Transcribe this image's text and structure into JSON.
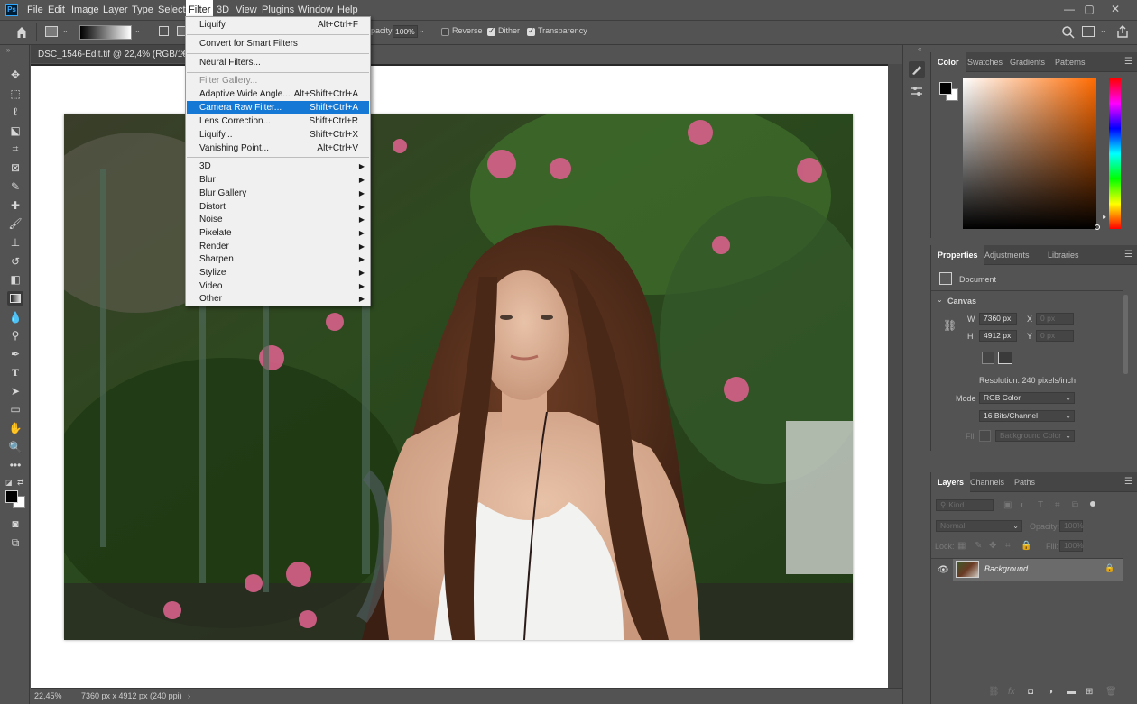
{
  "app": {
    "logo": "Ps"
  },
  "menubar": {
    "items": [
      "File",
      "Edit",
      "Image",
      "Layer",
      "Type",
      "Select",
      "Filter",
      "3D",
      "View",
      "Plugins",
      "Window",
      "Help"
    ],
    "active": "Filter"
  },
  "window_controls": {
    "minimize": "—",
    "maximize": "▢",
    "close": "✕"
  },
  "options_bar": {
    "opacity_label": "Opacity:",
    "opacity_value": "100%",
    "reverse_label": "Reverse",
    "reverse_checked": false,
    "dither_label": "Dither",
    "dither_checked": true,
    "transparency_label": "Transparency",
    "transparency_checked": true
  },
  "document": {
    "tab_title": "DSC_1546-Edit.tif @ 22,4% (RGB/16*)",
    "close_glyph": "×"
  },
  "filter_menu": {
    "items": [
      {
        "label": "Liquify",
        "shortcut": "Alt+Ctrl+F"
      },
      {
        "sep": true
      },
      {
        "label": "Convert for Smart Filters"
      },
      {
        "sep": true
      },
      {
        "label": "Neural Filters..."
      },
      {
        "sep": true
      },
      {
        "label": "Filter Gallery...",
        "disabled": true
      },
      {
        "label": "Adaptive Wide Angle...",
        "shortcut": "Alt+Shift+Ctrl+A"
      },
      {
        "label": "Camera Raw Filter...",
        "shortcut": "Shift+Ctrl+A",
        "highlighted": true
      },
      {
        "label": "Lens Correction...",
        "shortcut": "Shift+Ctrl+R"
      },
      {
        "label": "Liquify...",
        "shortcut": "Shift+Ctrl+X"
      },
      {
        "label": "Vanishing Point...",
        "shortcut": "Alt+Ctrl+V"
      },
      {
        "sep": true
      },
      {
        "label": "3D",
        "submenu": true
      },
      {
        "label": "Blur",
        "submenu": true
      },
      {
        "label": "Blur Gallery",
        "submenu": true
      },
      {
        "label": "Distort",
        "submenu": true
      },
      {
        "label": "Noise",
        "submenu": true
      },
      {
        "label": "Pixelate",
        "submenu": true
      },
      {
        "label": "Render",
        "submenu": true
      },
      {
        "label": "Sharpen",
        "submenu": true
      },
      {
        "label": "Stylize",
        "submenu": true
      },
      {
        "label": "Video",
        "submenu": true
      },
      {
        "label": "Other",
        "submenu": true
      }
    ]
  },
  "status_bar": {
    "zoom": "22,45%",
    "doc_info": "7360 px x 4912 px (240 ppi)",
    "arrow": "›"
  },
  "color_panel": {
    "tabs": [
      "Color",
      "Swatches",
      "Gradients",
      "Patterns"
    ],
    "active_tab": "Color",
    "foreground": "#000000",
    "background": "#ffffff",
    "hue_color": "#ff6a00"
  },
  "properties_panel": {
    "tabs": [
      "Properties",
      "Adjustments",
      "Libraries"
    ],
    "active_tab": "Properties",
    "doc_label": "Document",
    "section": "Canvas",
    "w_label": "W",
    "w_value": "7360 px",
    "h_label": "H",
    "h_value": "4912 px",
    "x_label": "X",
    "x_value": "0 px",
    "y_label": "Y",
    "y_value": "0 px",
    "resolution": "Resolution: 240 pixels/inch",
    "mode_label": "Mode",
    "mode_value": "RGB Color",
    "bits_value": "16 Bits/Channel",
    "fill_label": "Fill",
    "fill_value": "Background Color"
  },
  "layers_panel": {
    "tabs": [
      "Layers",
      "Channels",
      "Paths"
    ],
    "active_tab": "Layers",
    "kind_placeholder": "Kind",
    "blend_mode": "Normal",
    "opacity_label": "Opacity:",
    "opacity_value": "100%",
    "lock_label": "Lock:",
    "fill_label": "Fill:",
    "fill_value": "100%",
    "layers": [
      {
        "name": "Background",
        "visible": true,
        "locked": true
      }
    ],
    "footer_icons": [
      "link-icon",
      "fx-icon",
      "mask-icon",
      "adjustment-icon",
      "group-icon",
      "new-layer-icon",
      "trash-icon"
    ]
  }
}
